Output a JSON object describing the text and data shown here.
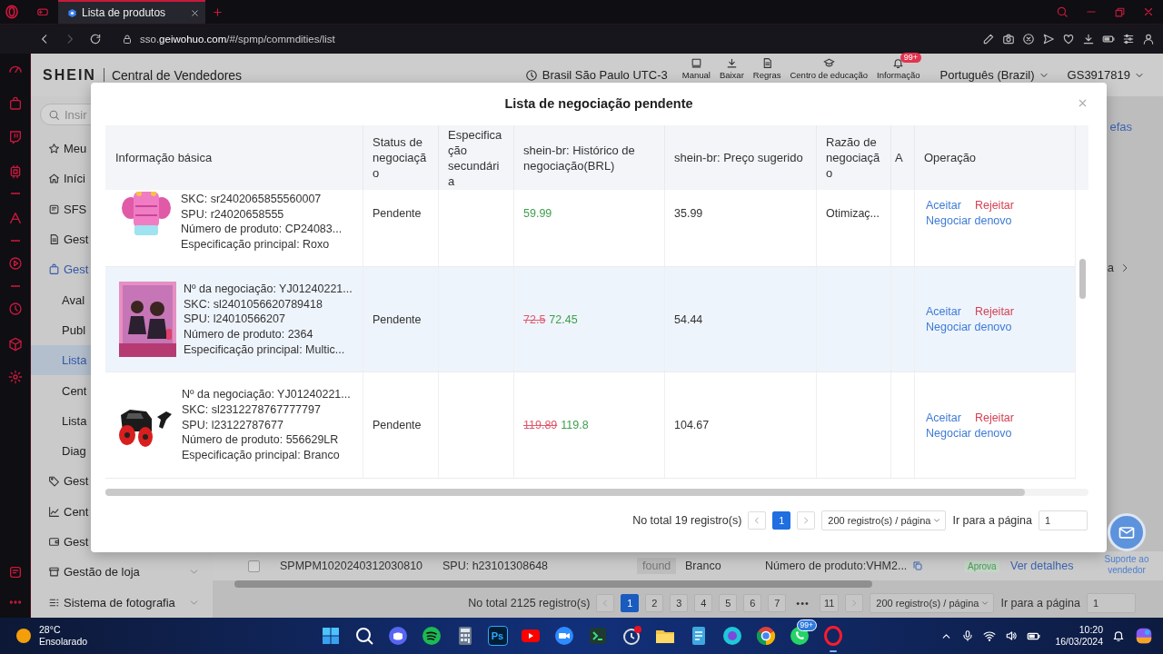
{
  "browser": {
    "tab": {
      "title": "Lista de produtos",
      "selected": true
    },
    "url": "sso.**geiwohuo.com**/#/spmp/commdities/list"
  },
  "header": {
    "brand": "SHEIN",
    "title": "Central de Vendedores",
    "timezone": "Brasil São Paulo UTC-3",
    "tools": [
      {
        "label": "Manual"
      },
      {
        "label": "Baixar"
      },
      {
        "label": "Regras"
      },
      {
        "label": "Centro de educação"
      },
      {
        "label": "Informação",
        "badge": "99+"
      }
    ],
    "language": "Português (Brazil)",
    "account": "GS3917819"
  },
  "sidebar": {
    "search": {
      "placeholder": "Insir"
    },
    "items": [
      {
        "label": "Meu",
        "kind": "top",
        "selected": false
      },
      {
        "label": "Iníci",
        "kind": "top",
        "selected": false
      },
      {
        "label": "SFS",
        "kind": "top",
        "selected": false
      },
      {
        "label": "Gest",
        "kind": "top",
        "selected": false
      },
      {
        "label": "Gest",
        "kind": "top",
        "selected": true
      },
      {
        "label": "Aval",
        "kind": "sub",
        "selected": false
      },
      {
        "label": "Publ",
        "kind": "sub",
        "selected": false
      },
      {
        "label": "Lista",
        "kind": "sub",
        "selected": true
      },
      {
        "label": "Cent",
        "kind": "sub",
        "selected": false
      },
      {
        "label": "Lista",
        "kind": "sub",
        "selected": false
      },
      {
        "label": "Diag",
        "kind": "sub",
        "selected": false
      },
      {
        "label": "Gest",
        "kind": "top",
        "selected": false
      },
      {
        "label": "Cent",
        "kind": "top",
        "selected": false
      },
      {
        "label": "Gest",
        "kind": "top",
        "selected": false
      },
      {
        "label": "Gestão de loja",
        "kind": "group",
        "selected": false,
        "expanded": false
      },
      {
        "label": "Sistema de fotografia",
        "kind": "group",
        "selected": false,
        "expanded": false
      }
    ]
  },
  "background": {
    "link_fragment": "efas",
    "panel_fragment": "a",
    "row": {
      "checked": false,
      "cells": [
        "SPMPM1020240312030810",
        "SPU: h23101308648",
        "found",
        "Branco",
        "Número de produto:VHM2..."
      ],
      "status": "Aprova",
      "action": "Ver detalhes"
    },
    "pagination": {
      "total": "No total 2125 registro(s)",
      "pages": [
        {
          "label": "1",
          "kind": "page",
          "selected": true
        },
        {
          "label": "2",
          "kind": "page",
          "selected": false
        },
        {
          "label": "3",
          "kind": "page",
          "selected": false
        },
        {
          "label": "4",
          "kind": "page",
          "selected": false
        },
        {
          "label": "5",
          "kind": "page",
          "selected": false
        },
        {
          "label": "6",
          "kind": "page",
          "selected": false
        },
        {
          "label": "7",
          "kind": "page",
          "selected": false
        },
        {
          "label": "•••",
          "kind": "ellipsis"
        },
        {
          "label": "11",
          "kind": "page",
          "selected": false
        }
      ],
      "page_size": "200 registro(s) / página",
      "goto_label": "Ir para a página",
      "goto_value": "1"
    }
  },
  "modal": {
    "title": "Lista de negociação pendente",
    "table": {
      "columns": [
        "Informação básica",
        "Status de negociação",
        "Especificação secundária",
        "shein-br: Histórico de negociação(BRL)",
        "shein-br: Preço sugerido",
        "Razão de negociação",
        "A",
        "Operação"
      ],
      "rows": [
        {
          "selected": false,
          "info": [
            "SKC: sr2402065855560007",
            "SPU: r24020658555",
            "Número de produto: CP24083...",
            "Especificação principal: Roxo"
          ],
          "status": "Pendente",
          "history": {
            "current": "59.99"
          },
          "suggested_price": "35.99",
          "reason": "Otimizaç...",
          "actions": [
            {
              "label": "Aceitar",
              "kind": "accept"
            },
            {
              "label": "Rejeitar",
              "kind": "reject"
            },
            {
              "label": "Negociar denovo",
              "kind": "renegotiate"
            }
          ]
        },
        {
          "selected": true,
          "info": [
            "Nº da negociação: YJ01240221...",
            "SKC: sl2401056620789418",
            "SPU: l24010566207",
            "Número de produto: 2364",
            "Especificação principal: Multic..."
          ],
          "status": "Pendente",
          "history": {
            "previous": "72.5",
            "current": "72.45"
          },
          "suggested_price": "54.44",
          "actions": [
            {
              "label": "Aceitar",
              "kind": "accept"
            },
            {
              "label": "Rejeitar",
              "kind": "reject"
            },
            {
              "label": "Negociar denovo",
              "kind": "renegotiate"
            }
          ]
        },
        {
          "selected": false,
          "info": [
            "Nº da negociação: YJ01240221...",
            "SKC: sl2312278767777797",
            "SPU: l23122787677",
            "Número de produto: 556629LR",
            "Especificação principal: Branco"
          ],
          "status": "Pendente",
          "history": {
            "previous": "119.89",
            "current": "119.8"
          },
          "suggested_price": "104.67",
          "actions": [
            {
              "label": "Aceitar",
              "kind": "accept"
            },
            {
              "label": "Rejeitar",
              "kind": "reject"
            },
            {
              "label": "Negociar denovo",
              "kind": "renegotiate"
            }
          ]
        }
      ]
    },
    "pagination": {
      "total": "No total 19 registro(s)",
      "pages": [
        {
          "label": "1",
          "kind": "page",
          "selected": true
        }
      ],
      "page_size": "200 registro(s) / página",
      "goto_label": "Ir para a página",
      "goto_value": "1"
    }
  },
  "support": {
    "label": "Suporte ao vendedor"
  },
  "taskbar": {
    "weather": {
      "temperature": "28°C",
      "condition": "Ensolarado"
    },
    "editor_label": "Ps",
    "chat_badge": "99+",
    "time": "10:20",
    "date": "16/03/2024"
  }
}
